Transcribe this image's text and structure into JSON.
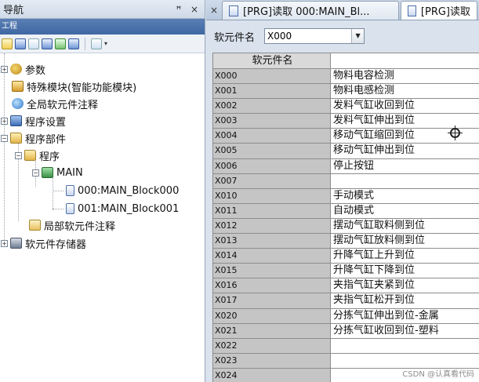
{
  "nav": {
    "title": "导航",
    "pin": "ꟸ",
    "close": "×",
    "sub_title": "工程",
    "tree": [
      {
        "label": "参数",
        "icon": "param-icon"
      },
      {
        "label": "特殊模块(智能功能模块)",
        "icon": "special-module-icon"
      },
      {
        "label": "全局软元件注释",
        "icon": "global-comment-icon"
      },
      {
        "label": "程序设置",
        "icon": "program-setting-icon"
      },
      {
        "label": "程序部件",
        "icon": "folder-icon"
      },
      {
        "label": "程序",
        "icon": "folder-icon"
      },
      {
        "label": "MAIN",
        "icon": "main-program-icon"
      },
      {
        "label": "000:MAIN_Block000",
        "icon": "block-icon"
      },
      {
        "label": "001:MAIN_Block001",
        "icon": "block-icon"
      },
      {
        "label": "局部软元件注释",
        "icon": "local-comment-icon"
      },
      {
        "label": "软元件存储器",
        "icon": "device-memory-icon"
      }
    ]
  },
  "tabs": {
    "close": "×",
    "items": [
      {
        "label": "[PRG]读取 000:MAIN_Bl..."
      },
      {
        "label": "[PRG]读取"
      }
    ]
  },
  "editor": {
    "filter_label": "软元件名",
    "filter_value": "X000",
    "column_name": "软元件名",
    "column_comment": "",
    "rows": [
      {
        "device": "X000",
        "comment": "物料电容检测"
      },
      {
        "device": "X001",
        "comment": "物料电感检测"
      },
      {
        "device": "X002",
        "comment": "发料气缸收回到位"
      },
      {
        "device": "X003",
        "comment": "发料气缸伸出到位"
      },
      {
        "device": "X004",
        "comment": "移动气缸缩回到位"
      },
      {
        "device": "X005",
        "comment": "移动气缸伸出到位"
      },
      {
        "device": "X006",
        "comment": "停止按钮"
      },
      {
        "device": "X007",
        "comment": ""
      },
      {
        "device": "X010",
        "comment": "手动模式"
      },
      {
        "device": "X011",
        "comment": "自动模式"
      },
      {
        "device": "X012",
        "comment": "摆动气缸取料侧到位"
      },
      {
        "device": "X013",
        "comment": "摆动气缸放料侧到位"
      },
      {
        "device": "X014",
        "comment": "升降气缸上升到位"
      },
      {
        "device": "X015",
        "comment": "升降气缸下降到位"
      },
      {
        "device": "X016",
        "comment": "夹指气缸夹紧到位"
      },
      {
        "device": "X017",
        "comment": "夹指气缸松开到位"
      },
      {
        "device": "X020",
        "comment": "分拣气缸伸出到位-金属"
      },
      {
        "device": "X021",
        "comment": "分拣气缸收回到位-塑料"
      },
      {
        "device": "X022",
        "comment": ""
      },
      {
        "device": "X023",
        "comment": ""
      },
      {
        "device": "X024",
        "comment": ""
      }
    ]
  },
  "watermark": "CSDN @认真看代码"
}
